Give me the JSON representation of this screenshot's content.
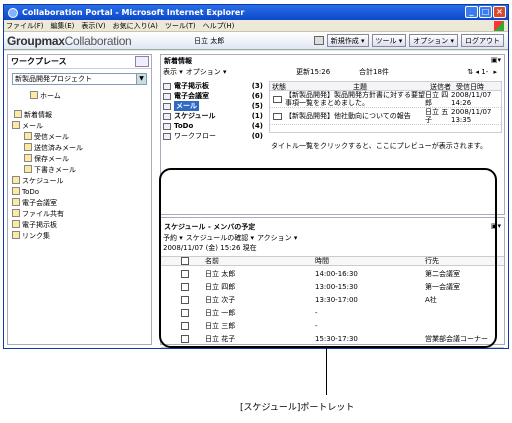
{
  "window": {
    "title": "Collaboration Portal - Microsoft Internet Explorer"
  },
  "menu": [
    "ファイル(F)",
    "編集(E)",
    "表示(V)",
    "お気に入り(A)",
    "ツール(T)",
    "ヘルプ(H)"
  ],
  "groupmax": {
    "brand": "Groupmax",
    "brand_suffix": "Collaboration",
    "user": "日立 太郎",
    "buttons": {
      "new": "新規作成 ▾",
      "tools": "ツール ▾",
      "options": "オプション ▾",
      "logout": "ログアウト"
    }
  },
  "workplace": {
    "title": "ワークプレース",
    "project": "新製品開発プロジェクト",
    "nav": [
      {
        "label": "ホーム",
        "icon": "home-icon"
      },
      {
        "label": "新着情報",
        "icon": "news-icon"
      },
      {
        "label": "メール",
        "icon": "mail-icon"
      },
      {
        "label": "受信メール",
        "icon": "inbox-icon"
      },
      {
        "label": "送信済みメール",
        "icon": "sent-icon"
      },
      {
        "label": "保存メール",
        "icon": "saved-mail-icon"
      },
      {
        "label": "下書きメール",
        "icon": "draft-icon"
      },
      {
        "label": "スケジュール",
        "icon": "clock-icon"
      },
      {
        "label": "ToDo",
        "icon": "todo-icon"
      },
      {
        "label": "電子会議室",
        "icon": "meeting-icon"
      },
      {
        "label": "ファイル共有",
        "icon": "share-icon"
      },
      {
        "label": "電子掲示板",
        "icon": "board-icon"
      },
      {
        "label": "リンク集",
        "icon": "link-icon"
      }
    ]
  },
  "newinfo": {
    "title": "新着情報",
    "toolbar": {
      "view": "表示 ▾",
      "option": "オプション ▾",
      "updated": "更新15:26",
      "total": "合計18件",
      "paging": "1-"
    },
    "categories": [
      {
        "label": "電子掲示板",
        "count": "(3)"
      },
      {
        "label": "電子会議室",
        "count": "(6)"
      },
      {
        "label": "メール",
        "count": "(5)"
      },
      {
        "label": "スケジュール",
        "count": "(1)"
      },
      {
        "label": "ToDo",
        "count": "(4)"
      },
      {
        "label": "ワークフロー",
        "count": "(0)"
      }
    ],
    "columns": [
      "状態",
      "主題",
      "送信者",
      "受信日時"
    ],
    "messages": [
      {
        "subject": "【新製品開発】製品開発方針書に対する要望事項一覧をまとめました。",
        "sender": "日立 四郎",
        "date": "2008/11/07 14:26"
      },
      {
        "subject": "【新製品開発】他社動向についての報告",
        "sender": "日立 五子",
        "date": "2008/11/07 13:35"
      }
    ],
    "preview": "タイトル一覧をクリックすると、ここにプレビューが表示されます。"
  },
  "schedule": {
    "title": "スケジュール - メンバの予定",
    "toolbar": {
      "reserve": "予約 ▾",
      "confirm": "スケジュールの確認 ▾",
      "action": "アクション ▾"
    },
    "date": "2008/11/07 (金) 15:26 現在",
    "columns": {
      "name": "名前",
      "time": "時間",
      "place": "行先"
    },
    "rows": [
      {
        "name": "日立 太郎",
        "time": "14:00-16:30",
        "place": "第二会議室"
      },
      {
        "name": "日立 四郎",
        "time": "13:00-15:30",
        "place": "第一会議室"
      },
      {
        "name": "日立 次子",
        "time": "13:30-17:00",
        "place": "A社"
      },
      {
        "name": "日立 一郎",
        "time": "-",
        "place": ""
      },
      {
        "name": "日立 三郎",
        "time": "-",
        "place": ""
      },
      {
        "name": "日立 花子",
        "time": "15:30-17:30",
        "place": "営業部会議コーナー"
      }
    ]
  },
  "caption": "[スケジュール]ポートレット"
}
